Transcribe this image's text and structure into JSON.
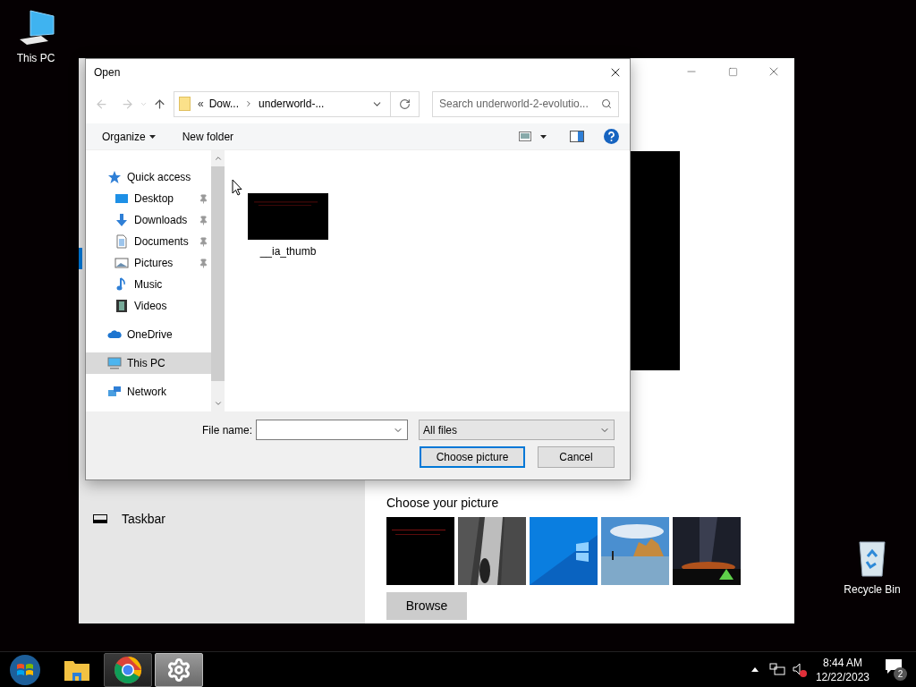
{
  "desktop_icons": [
    {
      "label": "This PC",
      "kind": "computer"
    },
    {
      "label": "Recycle Bin",
      "kind": "recycle"
    }
  ],
  "settings_window": {
    "sidebar_items": [
      {
        "label": "Taskbar",
        "selected": false
      }
    ],
    "picture_heading": "Choose your picture",
    "browse_button": "Browse"
  },
  "dialog": {
    "title": "Open",
    "breadcrumb_overflow": "«",
    "breadcrumb": [
      "Dow...",
      "underworld-..."
    ],
    "search": {
      "placeholder": "Search underworld-2-evolutio..."
    },
    "toolbar": {
      "organize": "Organize",
      "new_folder": "New folder"
    },
    "nav_pane": [
      {
        "label": "Quick access",
        "kind": "star",
        "selected": false,
        "children": [
          {
            "label": "Desktop",
            "kind": "desktop",
            "pinned": true
          },
          {
            "label": "Downloads",
            "kind": "downloads",
            "pinned": true
          },
          {
            "label": "Documents",
            "kind": "documents",
            "pinned": true
          },
          {
            "label": "Pictures",
            "kind": "pictures",
            "pinned": true
          },
          {
            "label": "Music",
            "kind": "music",
            "pinned": false
          },
          {
            "label": "Videos",
            "kind": "videos",
            "pinned": false
          }
        ]
      },
      {
        "label": "OneDrive",
        "kind": "cloud",
        "selected": false
      },
      {
        "label": "This PC",
        "kind": "computer",
        "selected": true
      },
      {
        "label": "Network",
        "kind": "network",
        "selected": false
      }
    ],
    "files": [
      {
        "name": "__ia_thumb"
      }
    ],
    "file_name": {
      "label": "File name:"
    },
    "file_type": "All files",
    "buttons": [
      {
        "label": "Choose picture",
        "default": true
      },
      {
        "label": "Cancel",
        "default": false
      }
    ]
  },
  "taskbar": {
    "apps": [
      {
        "kind": "start",
        "selected": false
      },
      {
        "kind": "explorer",
        "selected": false
      },
      {
        "kind": "chrome",
        "selected": false
      },
      {
        "kind": "settings",
        "selected": true
      }
    ],
    "time": "8:44 AM",
    "date": "12/22/2023",
    "notifications": "2"
  }
}
